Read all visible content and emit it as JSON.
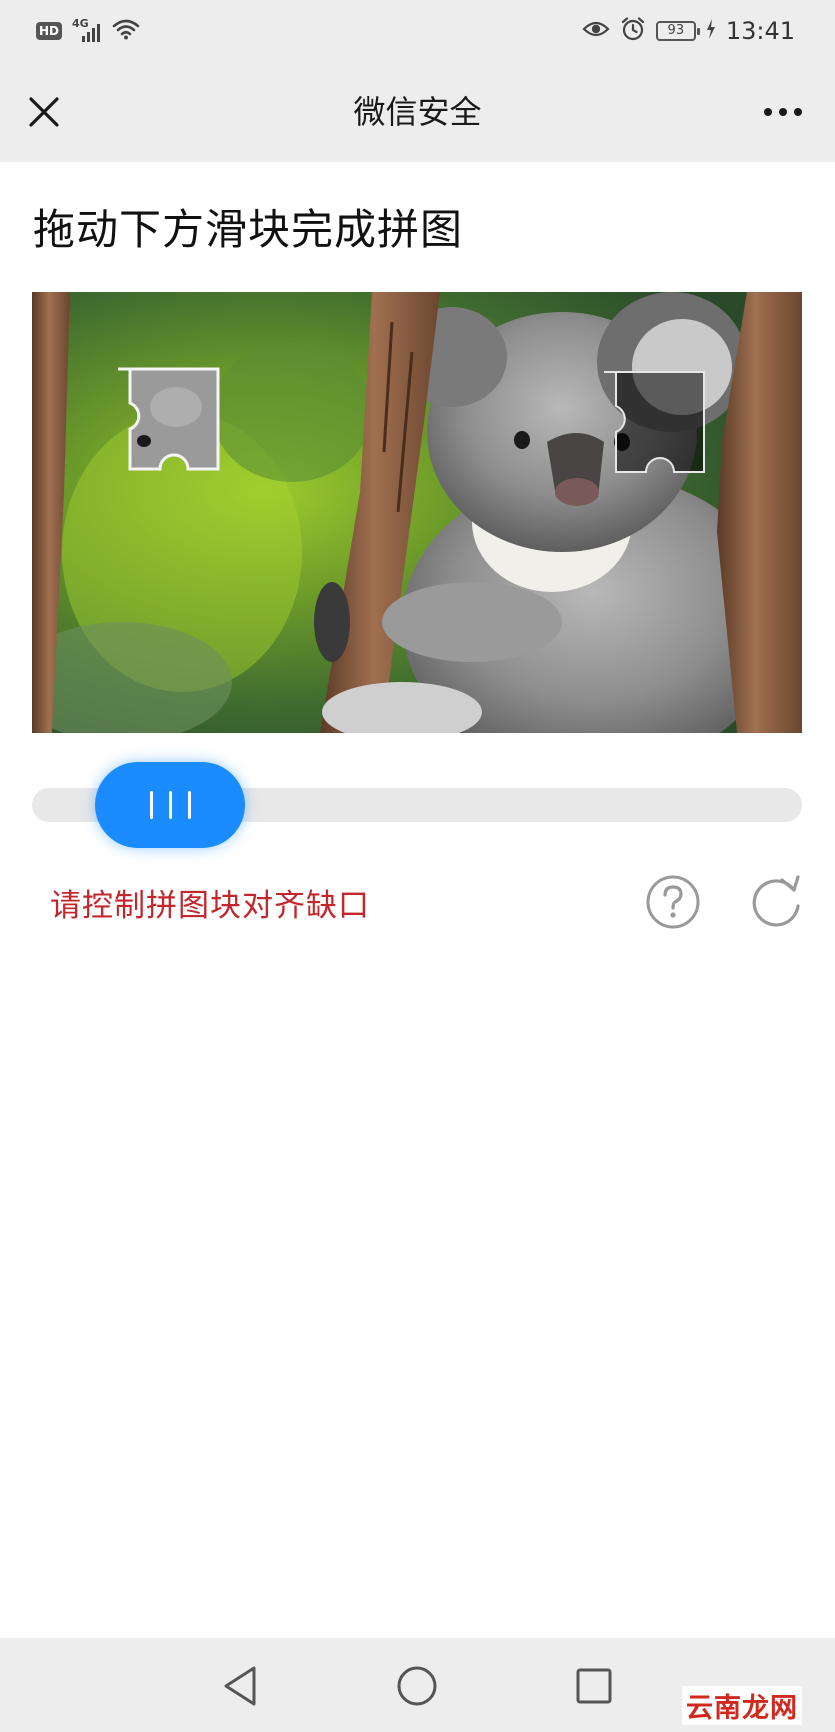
{
  "status_bar": {
    "hd_badge": "HD",
    "network": "4G",
    "battery": "93",
    "time": "13:41",
    "icons": [
      "hd-icon",
      "signal-icon",
      "wifi-icon",
      "eye-icon",
      "alarm-icon",
      "battery-icon",
      "charging-icon"
    ]
  },
  "nav": {
    "title": "微信安全",
    "close_icon": "close-icon",
    "more_icon": "more-icon"
  },
  "content": {
    "heading": "拖动下方滑块完成拼图",
    "slider_position_fraction": 0.08,
    "hint": "请控制拼图块对齐缺口",
    "help_icon": "help-icon",
    "refresh_icon": "refresh-icon"
  },
  "bottom_nav": {
    "icons": [
      "back-icon",
      "home-icon",
      "recents-icon"
    ]
  },
  "watermark": "云南龙网",
  "colors": {
    "accent": "#1a8cff",
    "hint": "#c1272d",
    "bar_bg": "#ededed",
    "watermark": "#d02a1e"
  }
}
